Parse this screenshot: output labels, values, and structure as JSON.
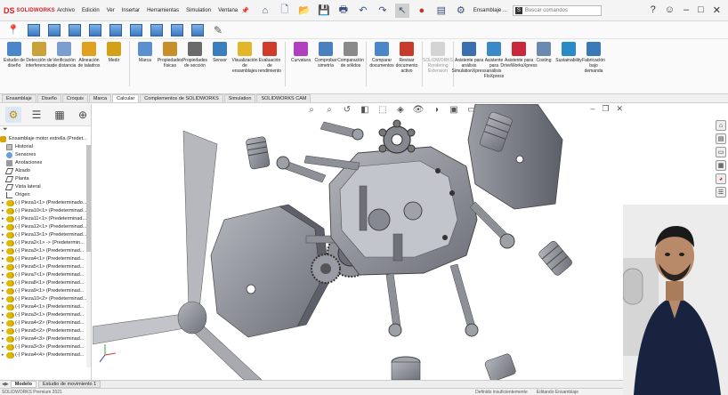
{
  "app": {
    "logo_ds": "DS",
    "logo_name": "SOLIDWORKS"
  },
  "menu": [
    "Archivo",
    "Edición",
    "Ver",
    "Insertar",
    "Herramientas",
    "Simulation",
    "Ventana"
  ],
  "titlebar": {
    "doc_title": "Ensamblaje ...",
    "search_placeholder": "Buscar comandos",
    "search_badge": "S"
  },
  "ribbon": {
    "commands": [
      {
        "label": "Estudio de diseño",
        "icon": "design-study-icon",
        "color": "#4a86c8"
      },
      {
        "label": "Detección de interferencias",
        "icon": "interference-icon",
        "color": "#c9a23a"
      },
      {
        "label": "Verificación de distancia",
        "icon": "clearance-icon",
        "color": "#7a9fcf"
      },
      {
        "label": "Alineación de taladros",
        "icon": "hole-alignment-icon",
        "color": "#e0a020"
      },
      {
        "label": "Medir",
        "icon": "measure-icon",
        "color": "#d4a017"
      },
      {
        "label": "Marca",
        "icon": "markup-icon",
        "color": "#5a8fd0"
      },
      {
        "label": "Propiedades físicas",
        "icon": "mass-properties-icon",
        "color": "#c88e2a"
      },
      {
        "label": "Propiedades de sección",
        "icon": "section-properties-icon",
        "color": "#6a6a6a"
      },
      {
        "label": "Sensor",
        "icon": "sensor-icon",
        "color": "#3a7ec0"
      },
      {
        "label": "Visualización de ensamblajes",
        "icon": "assembly-viz-icon",
        "color": "#e2b52a"
      },
      {
        "label": "Evaluación de rendimiento",
        "icon": "performance-icon",
        "color": "#d23a2a"
      },
      {
        "label": "Curvatura",
        "icon": "curvature-icon",
        "color": "#b040c0"
      },
      {
        "label": "Comprobar simetría",
        "icon": "symmetry-icon",
        "color": "#4a7fc0"
      },
      {
        "label": "Comparación de sólidos",
        "icon": "compare-bodies-icon",
        "color": "#8a8a8a"
      },
      {
        "label": "Comparar documentos",
        "icon": "compare-docs-icon",
        "color": "#4a86c8"
      },
      {
        "label": "Revisar documento activo",
        "icon": "check-doc-icon",
        "color": "#c83a2a"
      },
      {
        "label": "SOLIDWORKS Rendering Extension",
        "icon": "rendering-icon",
        "color": "#9a9a9a",
        "disabled": true
      },
      {
        "label": "Asistente para análisis SimulationXpress",
        "icon": "simxpress-icon",
        "color": "#3a6fb0"
      },
      {
        "label": "Asistente para análisis FloXpress",
        "icon": "floxpress-icon",
        "color": "#3a8ac8"
      },
      {
        "label": "Asistente para DriveWorksXpress",
        "icon": "driveworks-icon",
        "color": "#c8283a"
      },
      {
        "label": "Costing",
        "icon": "costing-icon",
        "color": "#6a8ab0"
      },
      {
        "label": "Sustainability",
        "icon": "sustainability-icon",
        "color": "#2a8ac8"
      },
      {
        "label": "Fabricación bajo demanda",
        "icon": "manufacturing-icon",
        "color": "#3a7ab8"
      }
    ]
  },
  "tabs": [
    "Ensamblaje",
    "Diseño",
    "Croquis",
    "Marca",
    "Calcular",
    "Complementos de SOLIDWORKS",
    "Simulation",
    "SOLIDWORKS CAM"
  ],
  "active_tab": "Calcular",
  "feature_tree": {
    "root": "Ensamblaje motor estrella (Predet...",
    "items": [
      {
        "label": "Historial",
        "icon": "history-icon"
      },
      {
        "label": "Sensores",
        "icon": "sensors-icon"
      },
      {
        "label": "Anotaciones",
        "icon": "annotations-icon"
      },
      {
        "label": "Alzado",
        "icon": "plane-icon"
      },
      {
        "label": "Planta",
        "icon": "plane-icon"
      },
      {
        "label": "Vista lateral",
        "icon": "plane-icon"
      },
      {
        "label": "Origen",
        "icon": "origin-icon"
      }
    ],
    "parts": [
      "(-) Pieza1<1> (Predeterminado...",
      "(-) Pieza10<1> (Predeterminad...",
      "(-) Pieza11<1> (Predeterminad...",
      "(-) Pieza12<1> (Predeterminad...",
      "(-) Pieza13<1> (Predeterminad...",
      "(-) Pieza2<1> -> (Predetermin...",
      "(-) Pieza3<1> (Predeterminad...",
      "(-) Pieza4<1> (Predeterminad...",
      "(-) Pieza5<1> (Predeterminad...",
      "(-) Pieza7<1> (Predeterminad...",
      "(-) Pieza8<1> (Predeterminad...",
      "(-) Pieza9<1> (Predeterminad...",
      "(-) Pieza10<2> (Predeterminad...",
      "(-) Pieza4<1> (Predeterminad...",
      "(-) Pieza3<1> (Predeterminad...",
      "(-) Pieza4<2> (Predeterminad...",
      "(-) Pieza5<2> (Predeterminad...",
      "(-) Pieza4<3> (Predeterminad...",
      "(-) Pieza3<3> (Predeterminad...",
      "(-) Pieza4<4> (Predeterminad..."
    ]
  },
  "bottom_tabs": [
    "Modelo",
    "Estudio de movimiento 1"
  ],
  "bottom_active": "Modelo",
  "status": {
    "left": "SOLIDWORKS Premium 2021",
    "middle": "Definido insuficientemente",
    "right": "Editando Ensamblaje"
  },
  "colors": {
    "accent": "#3b78c4",
    "brand": "#d62027",
    "part_yellow": "#e0b800"
  }
}
